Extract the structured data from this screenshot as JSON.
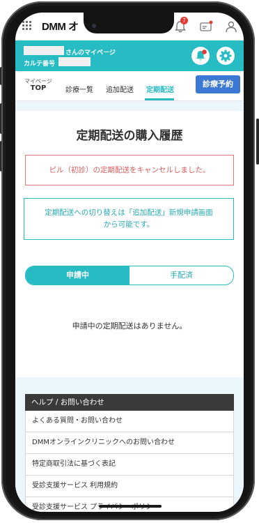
{
  "app": {
    "logo": "DMM オ",
    "notification_count": "7"
  },
  "header": {
    "mypage_suffix": "さんのマイページ",
    "karte_label": "カルテ番号"
  },
  "nav": {
    "items": [
      {
        "line1": "マイページ",
        "line2": "TOP"
      },
      {
        "label": "診療一覧"
      },
      {
        "label": "追加配送"
      },
      {
        "label": "定期配送"
      }
    ],
    "reserve_button": "診療予約"
  },
  "main": {
    "title": "定期配送の購入履歴",
    "alert": "ピル（初診）の定期配送をキャンセルしました。",
    "info_line1": "定期配送への切り替えは「追加配送」新規申請画面",
    "info_line2": "から可能です。",
    "tabs": [
      "申請中",
      "手配済"
    ],
    "empty_message": "申請中の定期配送はありません。"
  },
  "help": {
    "header": "ヘルプ / お問い合わせ",
    "items": [
      "よくある質問・お問い合わせ",
      "DMMオンラインクリニックへのお問い合わせ",
      "特定商取引法に基づく表記",
      "受診支援サービス 利用規約",
      "受診支援サービス プライバシーポリシー"
    ]
  },
  "colors": {
    "accent": "#27bcc4",
    "reserve": "#3a78d4",
    "alert": "#e05c5c",
    "badge": "#e53935"
  }
}
